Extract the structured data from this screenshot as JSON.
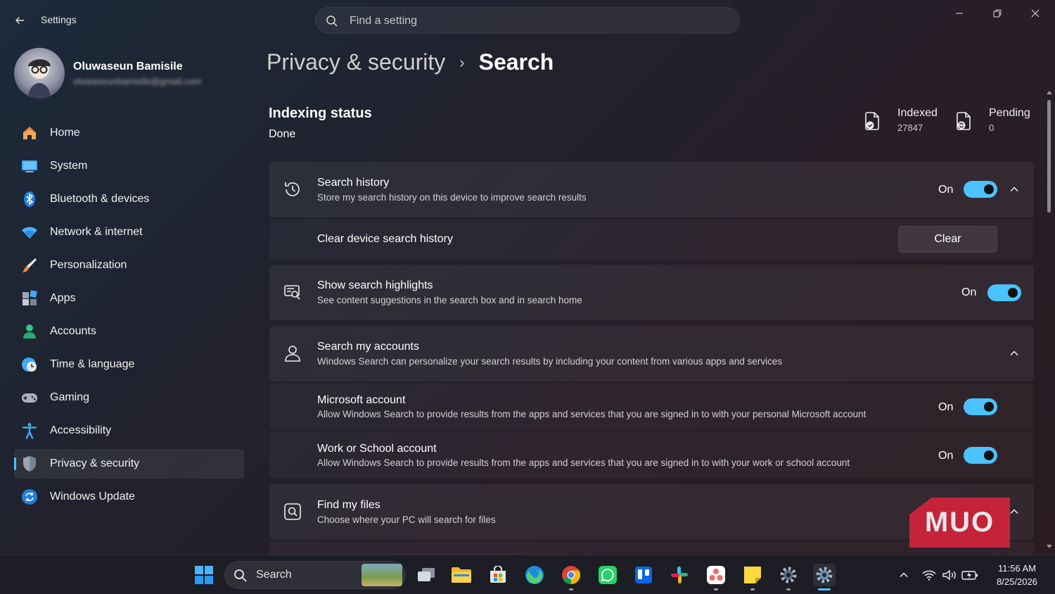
{
  "window": {
    "app_title": "Settings",
    "search_placeholder": "Find a setting"
  },
  "user": {
    "name": "Oluwaseun Bamisile",
    "email": "oluwaseunbamisile@gmail.com"
  },
  "sidebar": {
    "items": [
      {
        "label": "Home",
        "icon": "home-icon"
      },
      {
        "label": "System",
        "icon": "system-icon"
      },
      {
        "label": "Bluetooth & devices",
        "icon": "bluetooth-icon"
      },
      {
        "label": "Network & internet",
        "icon": "wifi-icon"
      },
      {
        "label": "Personalization",
        "icon": "brush-icon"
      },
      {
        "label": "Apps",
        "icon": "apps-icon"
      },
      {
        "label": "Accounts",
        "icon": "person-icon"
      },
      {
        "label": "Time & language",
        "icon": "clock-globe-icon"
      },
      {
        "label": "Gaming",
        "icon": "gamepad-icon"
      },
      {
        "label": "Accessibility",
        "icon": "accessibility-icon"
      },
      {
        "label": "Privacy & security",
        "icon": "shield-icon",
        "selected": true
      },
      {
        "label": "Windows Update",
        "icon": "update-icon"
      }
    ]
  },
  "breadcrumb": {
    "parent": "Privacy & security",
    "separator": "›",
    "current": "Search"
  },
  "indexing": {
    "title": "Indexing status",
    "value": "Done",
    "indexed_label": "Indexed",
    "indexed_value": "27847",
    "pending_label": "Pending",
    "pending_value": "0"
  },
  "settings": {
    "search_history": {
      "title": "Search history",
      "desc": "Store my search history on this device to improve search results",
      "state": "On"
    },
    "clear_history": {
      "title": "Clear device search history",
      "button": "Clear"
    },
    "highlights": {
      "title": "Show search highlights",
      "desc": "See content suggestions in the search box and in search home",
      "state": "On"
    },
    "my_accounts": {
      "title": "Search my accounts",
      "desc": "Windows Search can personalize your search results by including your content from various apps and services"
    },
    "microsoft_account": {
      "title": "Microsoft account",
      "desc": "Allow Windows Search to provide results from the apps and services that you are signed in to with your personal Microsoft account",
      "state": "On"
    },
    "work_account": {
      "title": "Work or School account",
      "desc": "Allow Windows Search to provide results from the apps and services that you are signed in to with your work or school account",
      "state": "On"
    },
    "find_files": {
      "title": "Find my files",
      "desc": "Choose where your PC will search for files"
    }
  },
  "watermark": "MUO",
  "taskbar": {
    "search_label": "Search",
    "time": "11:56 AM",
    "date": "8/25/2026"
  },
  "colors": {
    "accent": "#4cc2ff",
    "watermark_bg": "#c4233a"
  }
}
